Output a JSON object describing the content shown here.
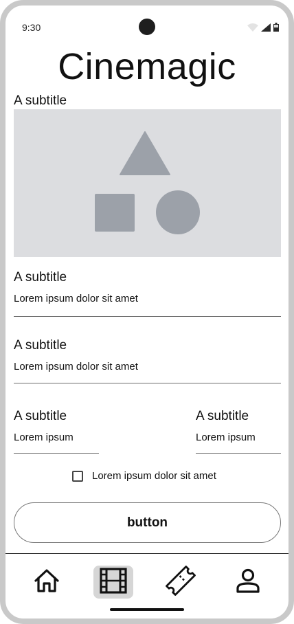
{
  "status_bar": {
    "time": "9:30",
    "icons": [
      "wifi-icon",
      "signal-icon",
      "battery-icon"
    ]
  },
  "app": {
    "title": "Cinemagic"
  },
  "hero": {
    "subtitle": "A subtitle",
    "image_placeholder_icons": [
      "triangle-shape",
      "square-shape",
      "circle-shape"
    ]
  },
  "sections": [
    {
      "subtitle": "A subtitle",
      "text": "Lorem ipsum dolor sit amet"
    },
    {
      "subtitle": "A subtitle",
      "text": "Lorem ipsum dolor sit amet"
    }
  ],
  "split_fields": [
    {
      "subtitle": "A subtitle",
      "text": "Lorem ipsum"
    },
    {
      "subtitle": "A subtitle",
      "text": "Lorem ipsum"
    }
  ],
  "checkbox": {
    "label": "Lorem ipsum dolor sit amet",
    "checked": false
  },
  "button": {
    "label": "button"
  },
  "bottom_nav": {
    "items": [
      {
        "icon": "home-icon",
        "active": false
      },
      {
        "icon": "film-icon",
        "active": true
      },
      {
        "icon": "ticket-icon",
        "active": false
      },
      {
        "icon": "person-icon",
        "active": false
      }
    ]
  },
  "colors": {
    "placeholder_bg": "#dcdde0",
    "placeholder_shape": "#9ca1a9",
    "active_nav_bg": "#d6d6d6",
    "frame": "#c9c9c9"
  }
}
